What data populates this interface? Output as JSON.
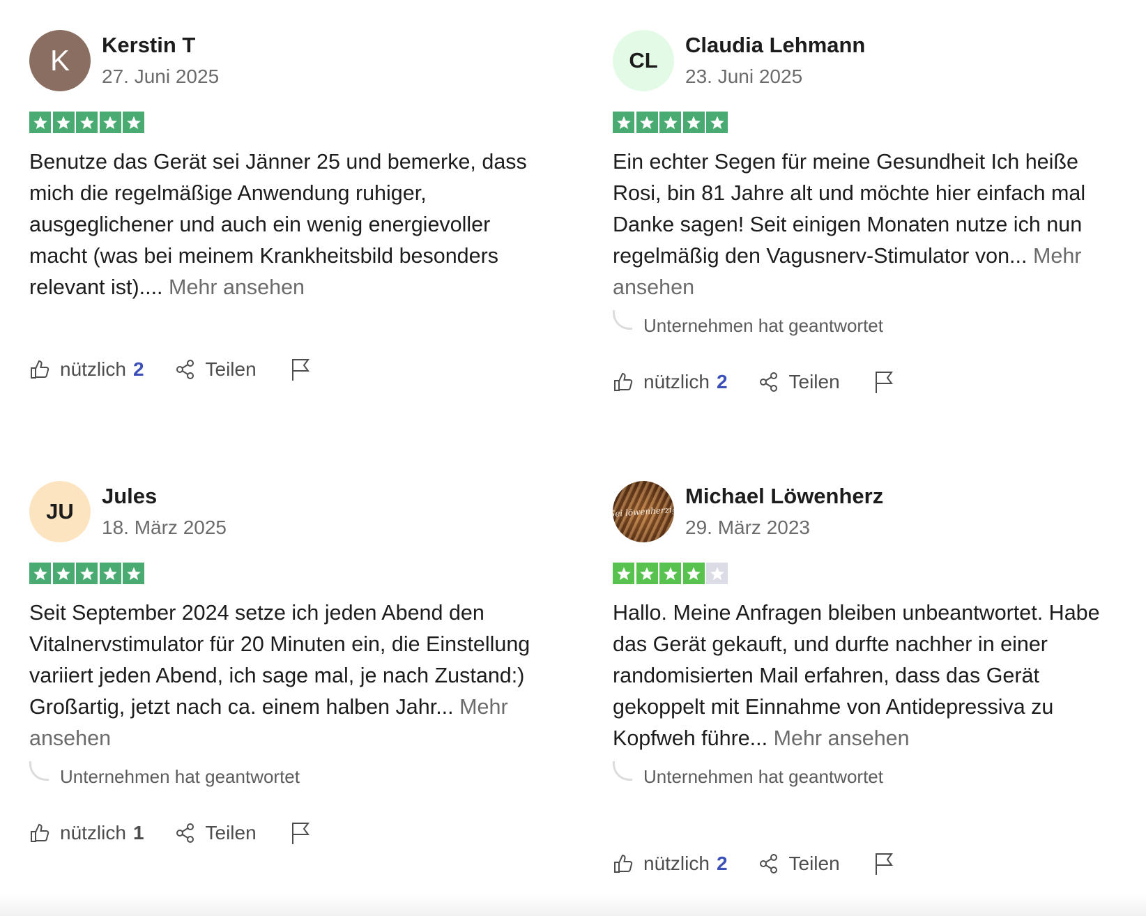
{
  "reviews": [
    {
      "avatar_text": "K",
      "avatar_color": "#8a6e62",
      "name": "Kerstin T",
      "date": "27. Juni 2025",
      "rating": 5,
      "text": "Benutze das Gerät sei Jänner 25 und bemerke, dass mich die regelmäßige Anwendung ruhiger, ausgeglichener und auch ein wenig energievoller macht (was bei meinem Krankheitsbild besonders relevant ist)....",
      "more": "Mehr ansehen",
      "reply": "",
      "useful_label": "nützlich",
      "useful_count": "2",
      "share_label": "Teilen"
    },
    {
      "avatar_text": "CL",
      "avatar_color": "#e3fbe6",
      "name": "Claudia Lehmann",
      "date": "23. Juni 2025",
      "rating": 5,
      "text": "Ein echter Segen für meine Gesundheit Ich heiße Rosi, bin 81 Jahre alt und möchte hier einfach mal Danke sagen! Seit einigen Monaten nutze ich nun regelmäßig den Vagusnerv-Stimulator von...",
      "more": "Mehr ansehen",
      "reply": "Unternehmen hat geantwortet",
      "useful_label": "nützlich",
      "useful_count": "2",
      "share_label": "Teilen"
    },
    {
      "avatar_text": "JU",
      "avatar_color": "#fde4c1",
      "name": "Jules",
      "date": "18. März 2025",
      "rating": 5,
      "text": "Seit September 2024 setze ich jeden Abend den Vitalnervstimulator für 20 Minuten ein, die Einstellung variiert jeden Abend, ich sage mal, je nach Zustand:) Großartig, jetzt nach ca. einem halben Jahr...",
      "more": "Mehr ansehen",
      "reply": "Unternehmen hat geantwortet",
      "useful_label": "nützlich",
      "useful_count": "1",
      "share_label": "Teilen"
    },
    {
      "avatar_text": "Sei löwenherzig",
      "avatar_color": "#7a4a24",
      "name": "Michael Löwenherz",
      "date": "29. März 2023",
      "rating": 4,
      "text": "Hallo. Meine Anfragen bleiben unbeantwortet. Habe das Gerät gekauft, und durfte nachher in einer randomisierten Mail erfahren, dass das Gerät gekoppelt mit Einnahme von Antidepressiva zu Kopfweh führe...",
      "more": "Mehr ansehen",
      "reply": "Unternehmen hat geantwortet",
      "useful_label": "nützlich",
      "useful_count": "2",
      "share_label": "Teilen"
    }
  ],
  "colors": {
    "star_5": "#4aab72",
    "star_4": "#58c24f",
    "star_empty": "#dcdce6",
    "count_accent": "#3b4fb8"
  },
  "icons": {
    "useful": "thumbs-up-icon",
    "share": "share-icon",
    "report": "flag-icon",
    "reply": "reply-curve-icon",
    "star": "star-icon"
  }
}
